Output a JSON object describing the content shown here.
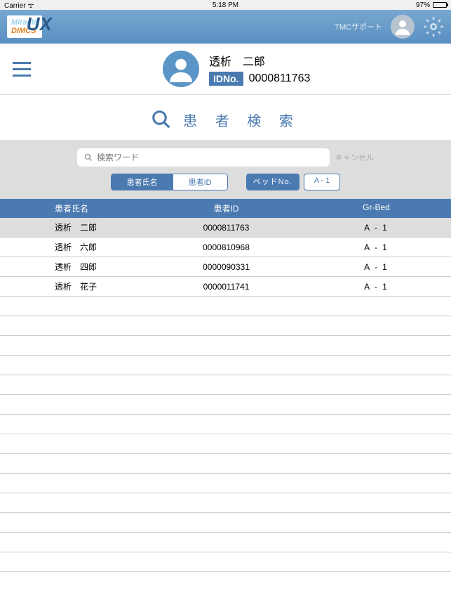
{
  "statusbar": {
    "left": "Carrier ᯤ",
    "center": "5:18 PM",
    "right": "97%"
  },
  "topbar": {
    "logo1": "Miracle",
    "logo2": "DIMCS",
    "logo3": "UX",
    "tmc": "TMCサポート"
  },
  "patient": {
    "name": "透析　二郎",
    "idno_label": "IDNo.",
    "id": "0000811763"
  },
  "title": "患 者 検 索",
  "search": {
    "placeholder": "検索ワード",
    "cancel": "キャンセル"
  },
  "segments": {
    "name": "患者氏名",
    "id": "患者ID"
  },
  "bed": {
    "label": "ベッドNo.",
    "value": "A  -  1"
  },
  "columns": {
    "c1": "患者氏名",
    "c2": "患者ID",
    "c3": "Gr-Bed"
  },
  "rows": [
    {
      "name": "透析　二郎",
      "id": "0000811763",
      "bed": "A - 1",
      "selected": true
    },
    {
      "name": "透析　六郎",
      "id": "0000810968",
      "bed": "A - 1",
      "selected": false
    },
    {
      "name": "透析　四郎",
      "id": "0000090331",
      "bed": "A - 1",
      "selected": false
    },
    {
      "name": "透析　花子",
      "id": "0000011741",
      "bed": "A - 1",
      "selected": false
    }
  ]
}
